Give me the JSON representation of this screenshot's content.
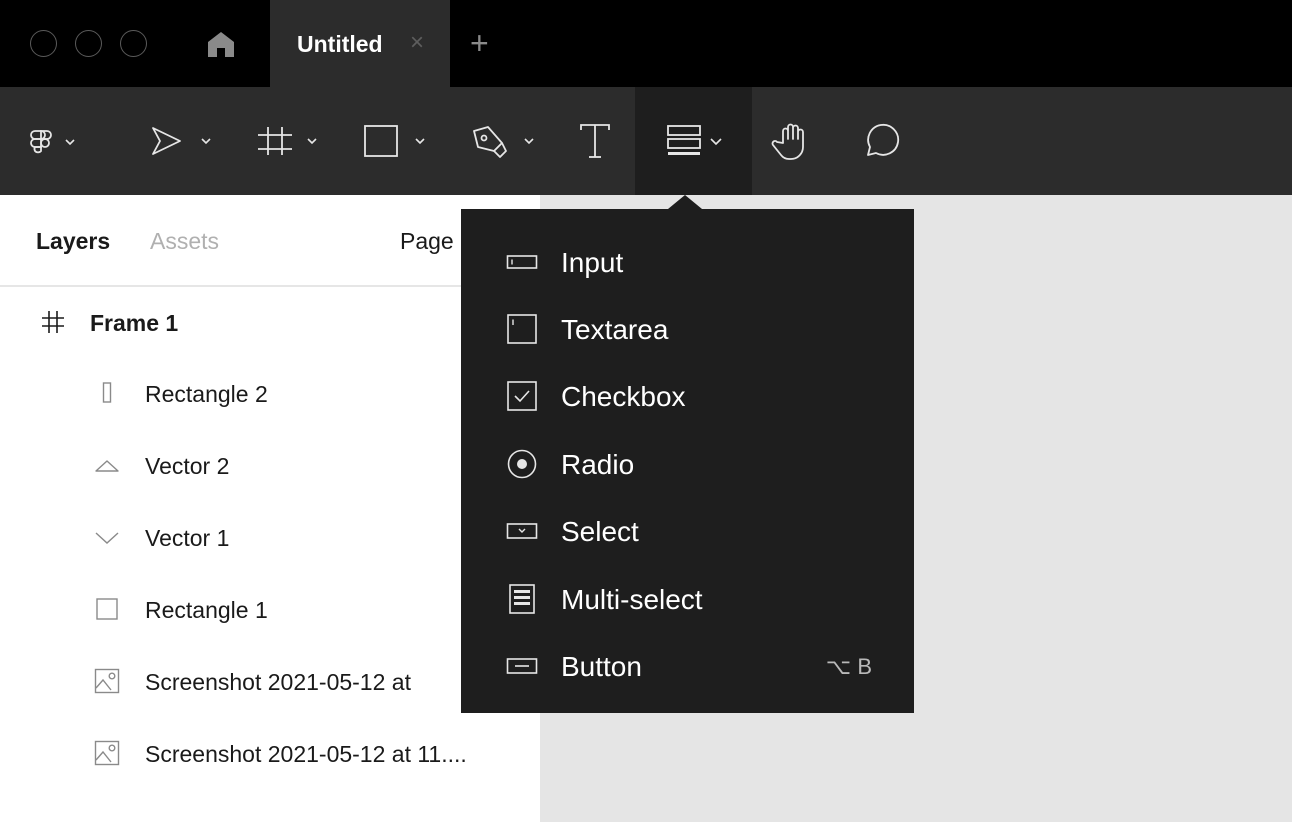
{
  "titlebar": {
    "tab_title": "Untitled",
    "tab_close_glyph": "×",
    "new_tab_glyph": "+"
  },
  "toolbar": {
    "tools": [
      {
        "name": "main-menu",
        "icon": "figma-logo-icon",
        "has_dropdown": true
      },
      {
        "name": "move-tool",
        "icon": "pointer-icon",
        "has_dropdown": true
      },
      {
        "name": "frame-tool",
        "icon": "frame-hash-icon",
        "has_dropdown": true
      },
      {
        "name": "shape-tool",
        "icon": "rectangle-icon",
        "has_dropdown": true
      },
      {
        "name": "pen-tool",
        "icon": "pen-icon",
        "has_dropdown": true
      },
      {
        "name": "text-tool",
        "icon": "text-icon",
        "has_dropdown": false
      },
      {
        "name": "form-components-tool",
        "icon": "form-components-icon",
        "has_dropdown": true,
        "active": true
      },
      {
        "name": "hand-tool",
        "icon": "hand-icon",
        "has_dropdown": false
      },
      {
        "name": "comment-tool",
        "icon": "comment-icon",
        "has_dropdown": false
      }
    ]
  },
  "panel": {
    "tabs": [
      "Layers",
      "Assets"
    ],
    "page_label": "Page",
    "layers": [
      {
        "name": "Frame 1",
        "icon": "frame-icon",
        "type": "frame"
      },
      {
        "name": "Rectangle 2",
        "icon": "thin-rectangle-icon",
        "type": "child"
      },
      {
        "name": "Vector 2",
        "icon": "vector-triangle-icon",
        "type": "child"
      },
      {
        "name": "Vector 1",
        "icon": "vector-chevron-icon",
        "type": "child"
      },
      {
        "name": "Rectangle 1",
        "icon": "rectangle-icon",
        "type": "child"
      },
      {
        "name": "Screenshot 2021-05-12 at",
        "icon": "image-icon",
        "type": "child"
      },
      {
        "name": "Screenshot 2021-05-12 at 11....",
        "icon": "image-icon",
        "type": "child"
      }
    ]
  },
  "dropdown": {
    "items": [
      {
        "label": "Input",
        "icon": "input-icon",
        "shortcut": ""
      },
      {
        "label": "Textarea",
        "icon": "textarea-icon",
        "shortcut": ""
      },
      {
        "label": "Checkbox",
        "icon": "checkbox-icon",
        "shortcut": ""
      },
      {
        "label": "Radio",
        "icon": "radio-icon",
        "shortcut": ""
      },
      {
        "label": "Select",
        "icon": "select-icon",
        "shortcut": ""
      },
      {
        "label": "Multi-select",
        "icon": "multi-select-icon",
        "shortcut": ""
      },
      {
        "label": "Button",
        "icon": "button-icon",
        "shortcut": "⌥ B"
      }
    ]
  },
  "colors": {
    "titlebar_bg": "#000000",
    "toolbar_bg": "#2c2c2c",
    "dropdown_bg": "#1e1e1e",
    "canvas_bg": "#e5e5e5",
    "icon_light": "#e6e6e6"
  }
}
